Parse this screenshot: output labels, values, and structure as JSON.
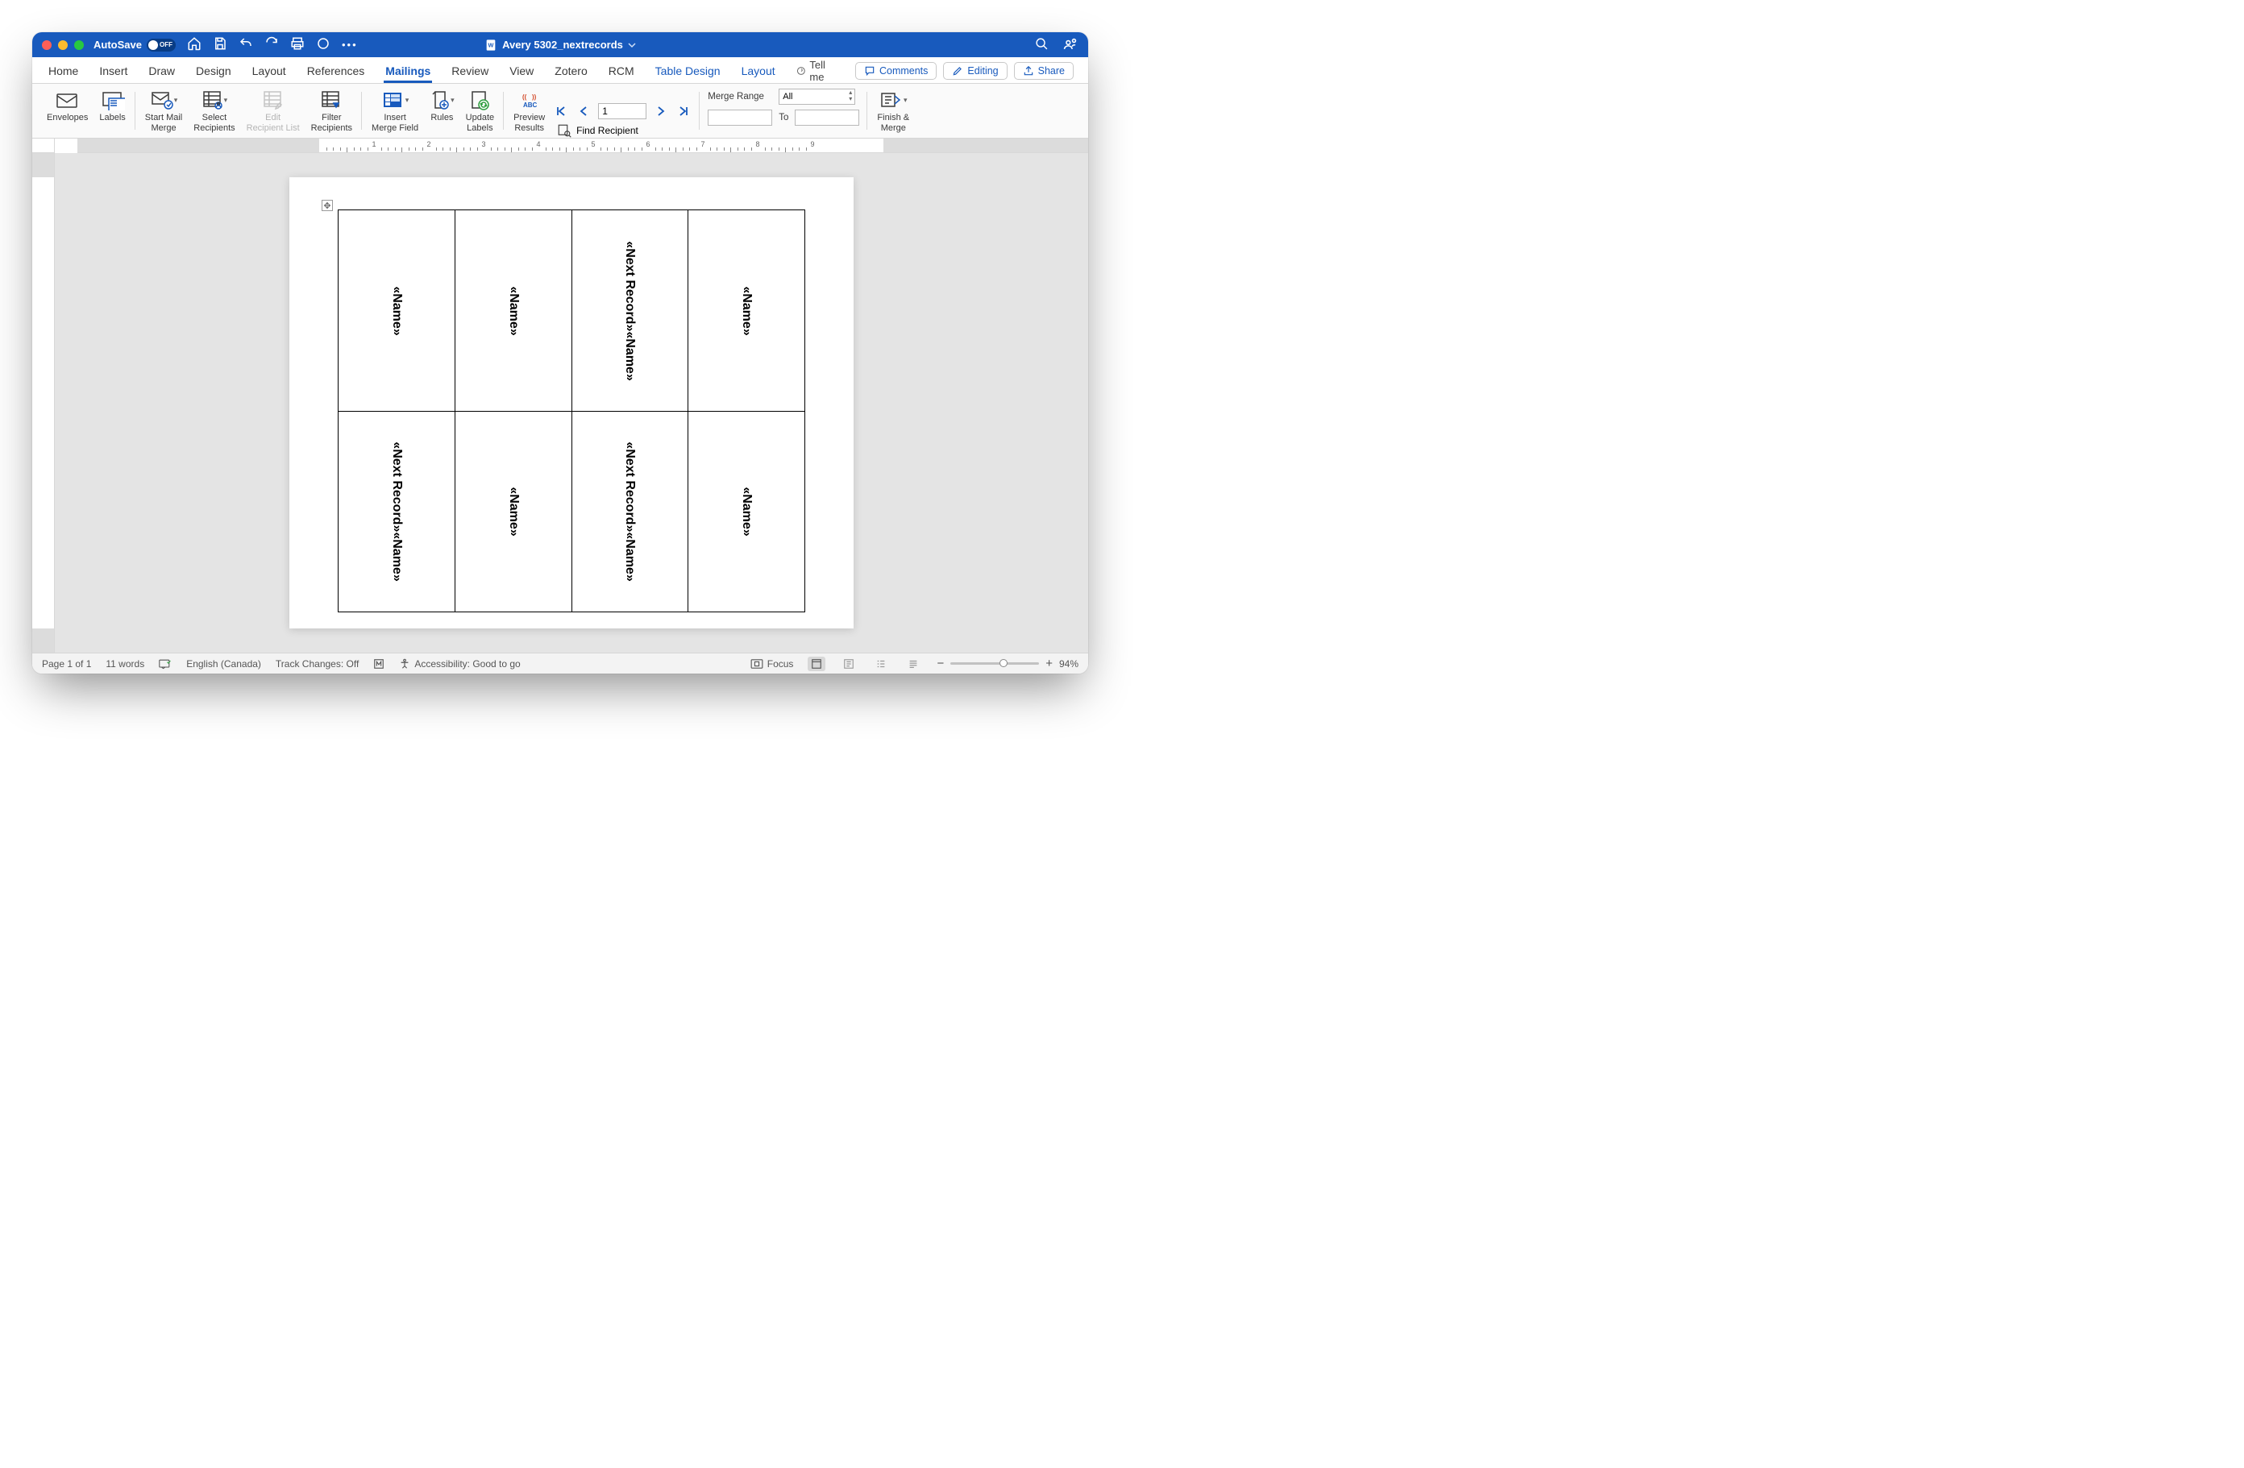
{
  "titlebar": {
    "autosave_label": "AutoSave",
    "autosave_state": "OFF",
    "doc_title": "Avery 5302_nextrecords"
  },
  "tabs": {
    "items": [
      "Home",
      "Insert",
      "Draw",
      "Design",
      "Layout",
      "References",
      "Mailings",
      "Review",
      "View",
      "Zotero",
      "RCM"
    ],
    "context": [
      "Table Design",
      "Layout"
    ],
    "active": "Mailings",
    "tellme": "Tell me"
  },
  "actions": {
    "comments": "Comments",
    "editing": "Editing",
    "share": "Share"
  },
  "ribbon": {
    "envelopes": "Envelopes",
    "labels": "Labels",
    "start_mail_merge": "Start Mail\nMerge",
    "select_recipients": "Select\nRecipients",
    "edit_recipient_list": "Edit\nRecipient List",
    "filter_recipients": "Filter\nRecipients",
    "insert_merge_field": "Insert\nMerge Field",
    "rules": "Rules",
    "update_labels": "Update\nLabels",
    "preview_results": "Preview\nResults",
    "find_recipient": "Find Recipient",
    "record_number": "1",
    "merge_range_label": "Merge Range",
    "merge_range_value": "All",
    "to_label": "To",
    "finish_merge": "Finish &\nMerge"
  },
  "document": {
    "cells": [
      "«Name»",
      "«Name»",
      "«Next Record»«Name»",
      "«Name»",
      "«Next Record»«Name»",
      "«Name»",
      "«Next Record»«Name»",
      "«Name»"
    ]
  },
  "status": {
    "page": "Page 1 of 1",
    "words": "11 words",
    "language": "English (Canada)",
    "track": "Track Changes: Off",
    "accessibility": "Accessibility: Good to go",
    "focus": "Focus",
    "zoom": "94%"
  }
}
